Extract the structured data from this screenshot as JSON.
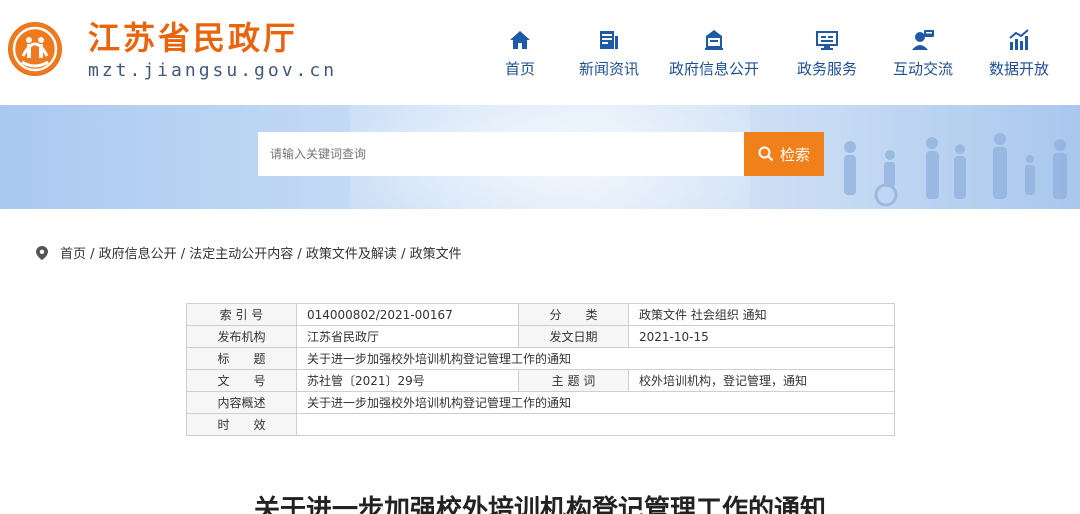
{
  "header": {
    "title": "江苏省民政厅",
    "domain": "mzt.jiangsu.gov.cn",
    "nav": [
      {
        "label": "首页",
        "icon": "home-icon"
      },
      {
        "label": "新闻资讯",
        "icon": "news-icon"
      },
      {
        "label": "政府信息公开",
        "icon": "government-building-icon"
      },
      {
        "label": "政务服务",
        "icon": "monitor-icon"
      },
      {
        "label": "互动交流",
        "icon": "chat-person-icon"
      },
      {
        "label": "数据开放",
        "icon": "chart-trend-icon"
      }
    ]
  },
  "search": {
    "placeholder": "请输入关键词查询",
    "button_label": "检索"
  },
  "breadcrumb": "首页 / 政府信息公开 / 法定主动公开内容 / 政策文件及解读 / 政策文件",
  "meta": {
    "index_label": "索 引 号",
    "index_value": "014000802/2021-00167",
    "category_label": "分　　类",
    "category_value": "政策文件 社会组织 通知",
    "publisher_label": "发布机构",
    "publisher_value": "江苏省民政厅",
    "date_label": "发文日期",
    "date_value": "2021-10-15",
    "title_label": "标　　题",
    "title_value": "关于进一步加强校外培训机构登记管理工作的通知",
    "docno_label": "文　　号",
    "docno_value": "苏社管〔2021〕29号",
    "keywords_label": "主 题 词",
    "keywords_value": "校外培训机构，登记管理，通知",
    "summary_label": "内容概述",
    "summary_value": "关于进一步加强校外培训机构登记管理工作的通知",
    "validity_label": "时　　效",
    "validity_value": ""
  },
  "document": {
    "title": "关于进一步加强校外培训机构登记管理工作的通知"
  },
  "colors": {
    "brand_orange": "#e8650d",
    "nav_blue": "#1f4f93",
    "search_button": "#f0801a"
  }
}
